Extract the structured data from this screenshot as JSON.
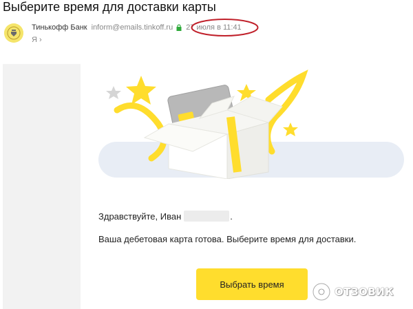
{
  "email": {
    "subject": "Выберите время для доставки карты",
    "sender_name": "Тинькофф Банк",
    "sender_email": "inform@emails.tinkoff.ru",
    "date": "27 июля в 11:41",
    "recipient": "Я ›"
  },
  "body": {
    "greeting_start": "Здравствуйте, Иван",
    "greeting_end": ".",
    "message": "Ваша дебетовая карта готова. Выберите время для доставки.",
    "cta_label": "Выбрать время"
  },
  "watermark": {
    "text": "ОТЗОВИК"
  },
  "colors": {
    "brand_yellow": "#ffdd2d",
    "highlight_red": "#c0202a",
    "banner_band": "#e8edf5",
    "lock_green": "#2eaa3a"
  },
  "icons": {
    "avatar": "tinkoff-logo-icon",
    "secure": "lock-icon",
    "watermark": "otzovik-logo-icon"
  }
}
